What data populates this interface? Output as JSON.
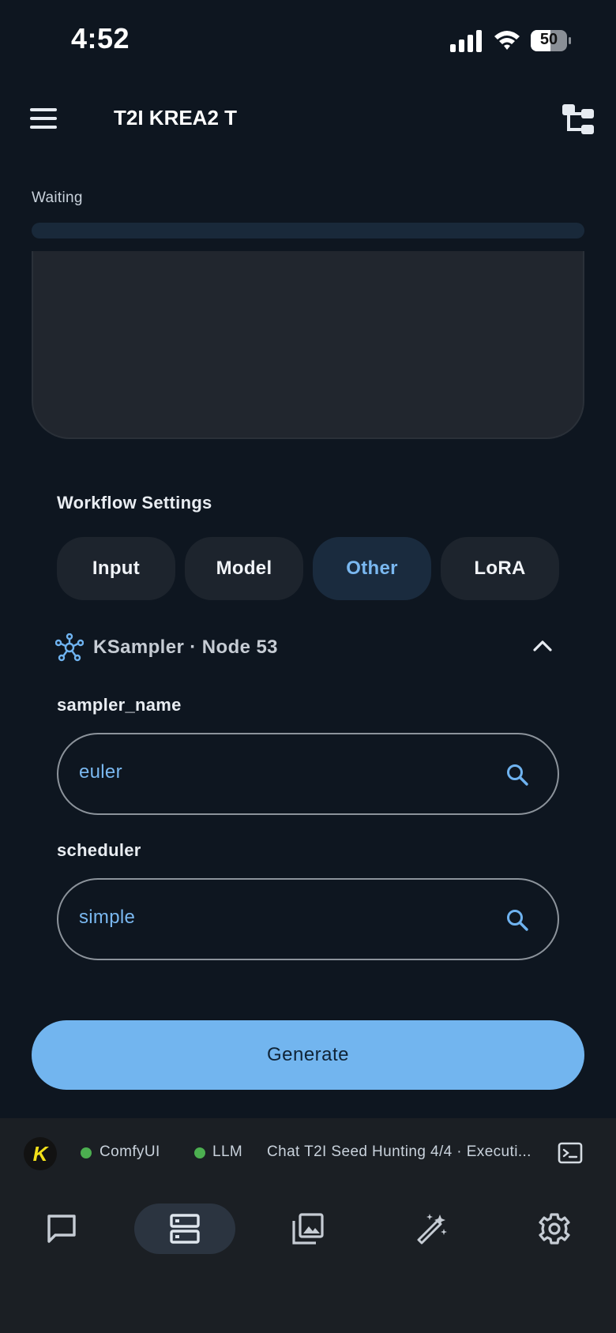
{
  "status_bar": {
    "time": "4:52",
    "battery": "50"
  },
  "app_bar": {
    "title": "T2I KREA2 T",
    "menu_icon": "menu-icon",
    "action_icon": "workflow-tree-icon"
  },
  "progress": {
    "label": "Waiting",
    "fraction": 0
  },
  "workflow_settings": {
    "title": "Workflow Settings",
    "tabs": [
      {
        "label": "Input",
        "active": false
      },
      {
        "label": "Model",
        "active": false
      },
      {
        "label": "Other",
        "active": true
      },
      {
        "label": "LoRA",
        "active": false
      }
    ],
    "node": {
      "title": "KSampler · Node 53",
      "icon": "node-graph-icon",
      "expanded": true
    },
    "fields": [
      {
        "label": "sampler_name",
        "value": "euler"
      },
      {
        "label": "scheduler",
        "value": "simple"
      }
    ]
  },
  "generate_label": "Generate",
  "footer_status": {
    "avatar_letter": "K",
    "comfyui_label": "ComfyUI",
    "llm_label": "LLM",
    "job_text": "Chat T2I Seed Hunting 4/4 · Executi...",
    "online_color": "#4caf50"
  },
  "bottom_nav": [
    {
      "icon": "chat-icon",
      "active": false
    },
    {
      "icon": "server-icon",
      "active": true
    },
    {
      "icon": "gallery-icon",
      "active": false
    },
    {
      "icon": "magic-wand-icon",
      "active": false
    },
    {
      "icon": "settings-gear-icon",
      "active": false
    }
  ],
  "colors": {
    "background": "#0e1620",
    "accent": "#72b5ef",
    "tab_active_text": "#7ab8f0"
  }
}
